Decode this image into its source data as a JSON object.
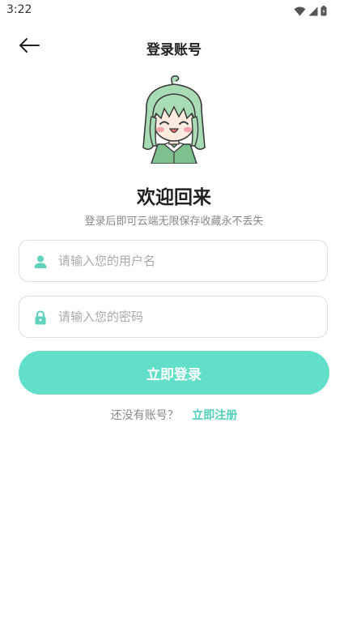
{
  "status_bar": {
    "time": "3:22",
    "icons": [
      "wifi-icon",
      "cellular-signal-icon",
      "battery-icon"
    ]
  },
  "header": {
    "back_icon": "arrow-left-icon",
    "title": "登录账号"
  },
  "welcome": {
    "avatar": "anime-girl-mascot",
    "title": "欢迎回来",
    "subtitle": "登录后即可云端无限保存收藏永不丢失"
  },
  "form": {
    "username": {
      "icon": "user-icon",
      "placeholder": "请输入您的用户名",
      "value": ""
    },
    "password": {
      "icon": "lock-icon",
      "placeholder": "请输入您的密码",
      "value": ""
    },
    "login_label": "立即登录"
  },
  "footer": {
    "prompt": "还没有账号？",
    "register_link": "立即注册"
  },
  "colors": {
    "accent": "#62dfc9",
    "icon_teal": "#5fd2c0",
    "button_bg": "#62dfc9"
  }
}
